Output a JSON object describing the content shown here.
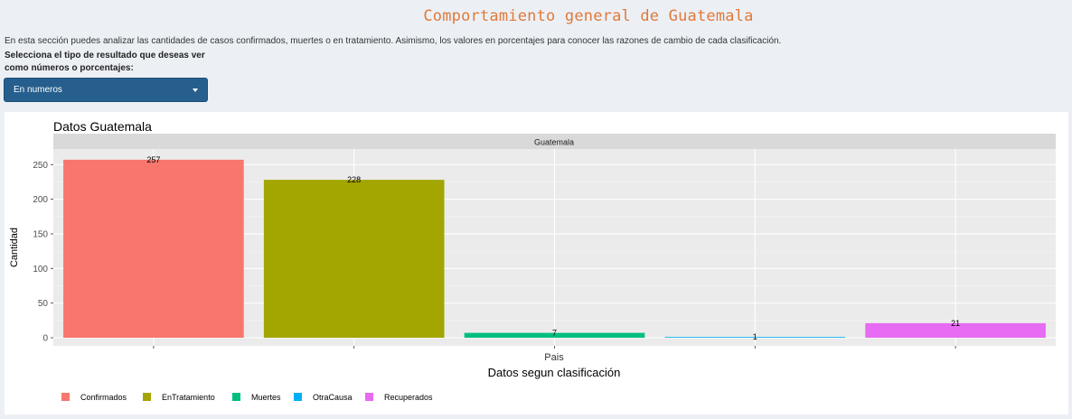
{
  "header": {
    "title": "Comportamiento general de Guatemala",
    "description": "En esta sección puedes analizar las cantidades de casos confirmados, muertes o en tratamiento. Asimismo, los valores en porcentajes para conocer las razones de cambio de cada clasificación.",
    "select_label_line1": "Selecciona el tipo de resultado que deseas ver",
    "select_label_line2": "como números o porcentajes:"
  },
  "controls": {
    "result_type": {
      "selected": "En numeros"
    }
  },
  "colors": {
    "title": "#e0793a",
    "dropdown_bg": "#265f8e",
    "panel_bg": "#ebebeb",
    "strip_bg": "#d9d9d9"
  },
  "chart_data": {
    "type": "bar",
    "title": "Datos Guatemala",
    "facet_label": "Guatemala",
    "xlabel": "Datos segun clasificación",
    "x_tick_label": "Pais",
    "ylabel": "Cantidad",
    "ylim": [
      0,
      270
    ],
    "y_ticks": [
      0,
      50,
      100,
      150,
      200,
      250
    ],
    "grid": true,
    "legend_position": "bottom",
    "categories": [
      "Confirmados",
      "EnTratamiento",
      "Muertes",
      "OtraCausa",
      "Recuperados"
    ],
    "values": [
      257,
      228,
      7,
      1,
      21
    ],
    "series_colors": [
      "#f8766d",
      "#a3a500",
      "#00bf7d",
      "#00b0f6",
      "#e76bf3"
    ]
  }
}
